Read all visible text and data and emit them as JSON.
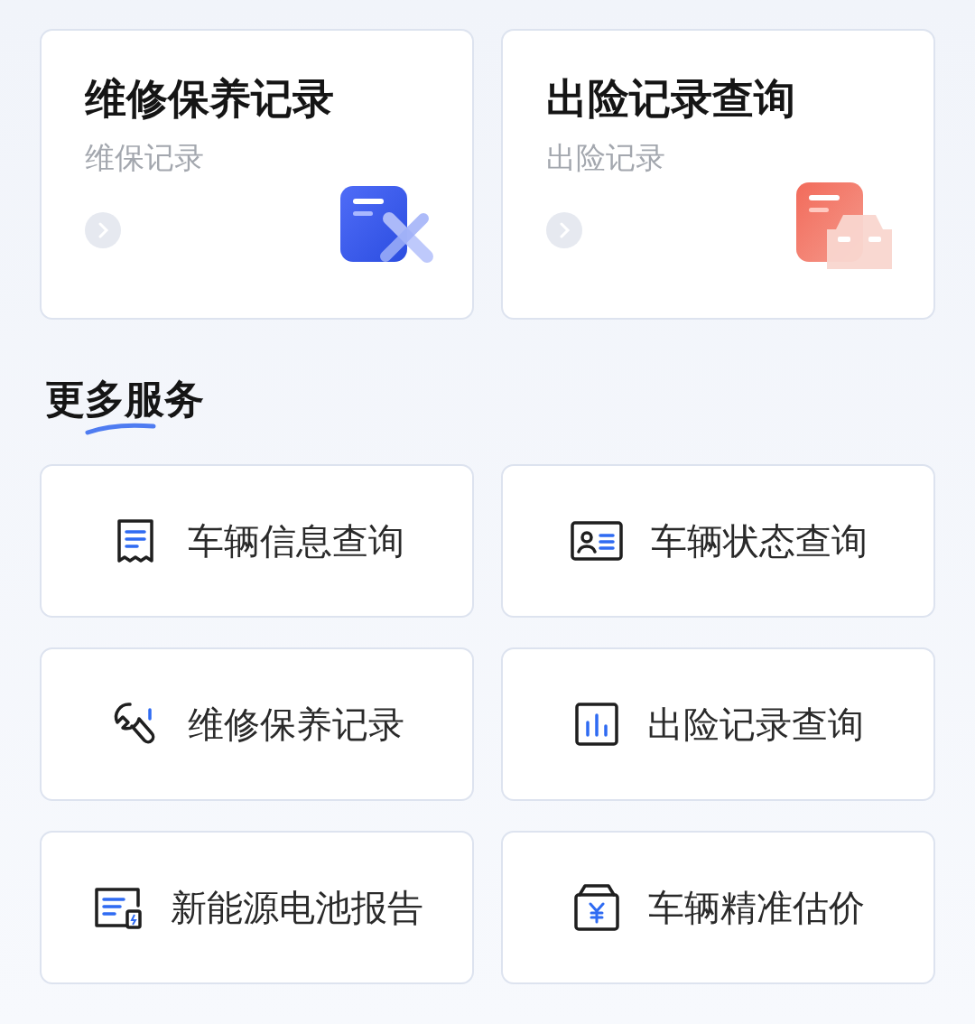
{
  "record_cards": [
    {
      "title": "维修保养记录",
      "subtitle": "维保记录",
      "kind": "maintenance"
    },
    {
      "title": "出险记录查询",
      "subtitle": "出险记录",
      "kind": "accident"
    }
  ],
  "section_title": "更多服务",
  "services": [
    {
      "label": "车辆信息查询",
      "kind": "receipt"
    },
    {
      "label": "车辆状态查询",
      "kind": "id-card"
    },
    {
      "label": "维修保养记录",
      "kind": "wrench"
    },
    {
      "label": "出险记录查询",
      "kind": "chart"
    },
    {
      "label": "新能源电池报告",
      "kind": "battery"
    },
    {
      "label": "车辆精准估价",
      "kind": "price"
    }
  ]
}
